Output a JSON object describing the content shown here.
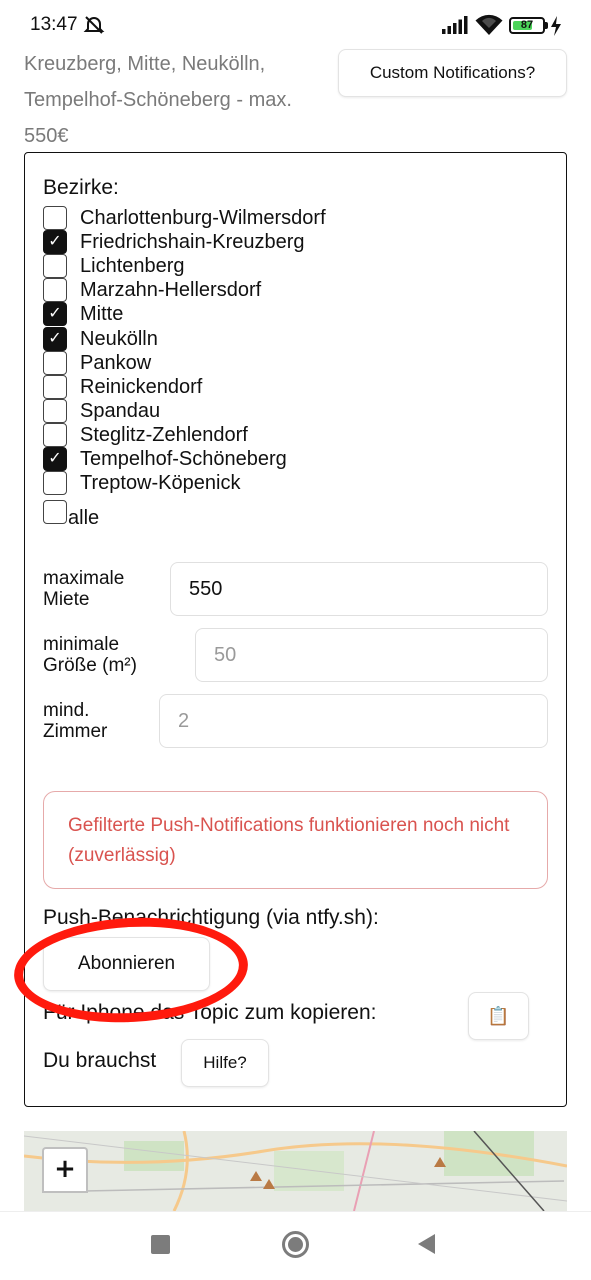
{
  "status_bar": {
    "time": "13:47",
    "battery_level": "87",
    "icons": [
      "dnd-icon",
      "signal-icon",
      "wifi-icon",
      "battery-icon",
      "charging-icon"
    ]
  },
  "header": {
    "summary": "Kreuzberg, Mitte, Neukölln, Tempelhof-Schöneberg - max. 550€",
    "custom_notifications_label": "Custom Notifications?"
  },
  "filters": {
    "districts_label": "Bezirke:",
    "districts": [
      {
        "name": "Charlottenburg-Wilmersdorf",
        "checked": false
      },
      {
        "name": "Friedrichshain-Kreuzberg",
        "checked": true
      },
      {
        "name": "Lichtenberg",
        "checked": false
      },
      {
        "name": "Marzahn-Hellersdorf",
        "checked": false
      },
      {
        "name": "Mitte",
        "checked": true
      },
      {
        "name": "Neukölln",
        "checked": true
      },
      {
        "name": "Pankow",
        "checked": false
      },
      {
        "name": "Reinickendorf",
        "checked": false
      },
      {
        "name": "Spandau",
        "checked": false
      },
      {
        "name": "Steglitz-Zehlendorf",
        "checked": false
      },
      {
        "name": "Tempelhof-Schöneberg",
        "checked": true
      },
      {
        "name": "Treptow-Köpenick",
        "checked": false
      }
    ],
    "all_label": "alle",
    "all_checked": false,
    "max_rent_label_line1": "maximale",
    "max_rent_label_line2": "Miete",
    "max_rent_value": "550",
    "min_size_label_line1": "minimale",
    "min_size_label_line2": "Größe (m²)",
    "min_size_placeholder": "50",
    "min_rooms_label_line1": "mind.",
    "min_rooms_label_line2": "Zimmer",
    "min_rooms_placeholder": "2"
  },
  "notifications": {
    "warning": "Gefilterte Push-Notifications funktionieren noch nicht (zuverlässig)",
    "push_label": "Push-Benachrichtigung (via ntfy.sh):",
    "subscribe_label": "Abonnieren",
    "iphone_label": "Für Iphone das Topic zum kopieren:",
    "copy_icon": "📋",
    "need_label": "Du brauchst",
    "help_label": "Hilfe?"
  },
  "map": {
    "zoom_in_label": "+"
  },
  "colors": {
    "warning_text": "#d9534f",
    "warning_border": "#e6aaaa",
    "annotation": "#ff1a0d",
    "summary_text": "#7a7a7a"
  }
}
